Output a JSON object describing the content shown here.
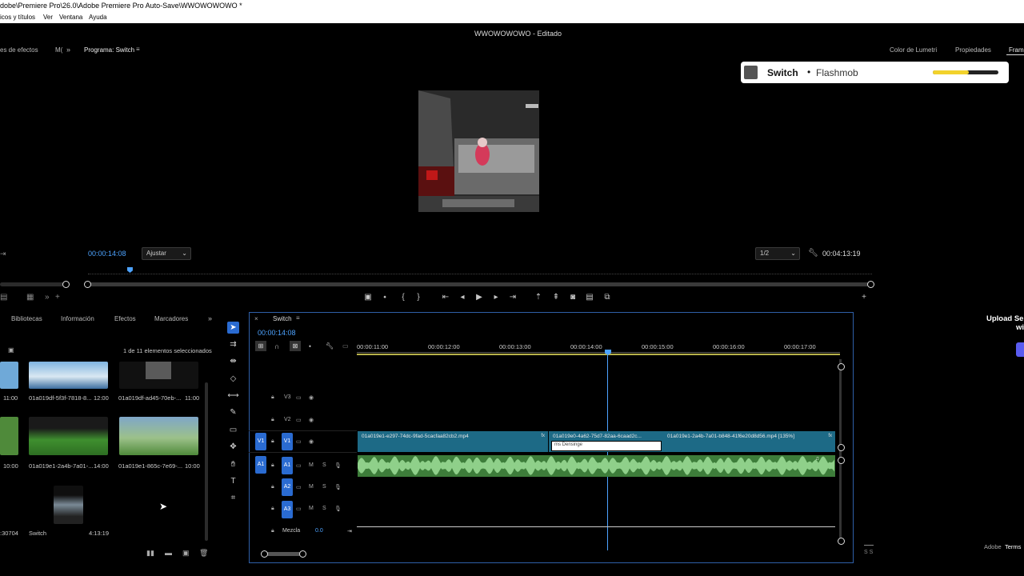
{
  "window": {
    "title": "dobe\\Premiere Pro\\26.0\\Adobe Premiere Pro Auto-Save\\WWOWOWOWO *",
    "menu": [
      "icos y títulos",
      "Ver",
      "Ventana",
      "Ayuda"
    ]
  },
  "header": {
    "doc_title": "WWOWOWOWO - Editado",
    "left_tabs": [
      "es de efectos",
      "M(",
      "Programa: Switch"
    ],
    "right_tabs": [
      "Color de Lumetri",
      "Propiedades",
      "Frame"
    ]
  },
  "overlay": {
    "name": "Switch",
    "separator": "•",
    "brand": "Flashmob",
    "progress": 0.55,
    "accent": "#f2d22c"
  },
  "program_monitor": {
    "timecode": "00:00:14:08",
    "fit_value": "Ajustar",
    "resolution": "1/2",
    "duration": "00:04:13:19",
    "playhead_fraction": 0.053
  },
  "project_panel": {
    "tabs": [
      "Bibliotecas",
      "Información",
      "Efectos",
      "Marcadores"
    ],
    "selection_status": "1 de 11 elementos seleccionados",
    "items": [
      {
        "label": "",
        "duration": "11:00"
      },
      {
        "label": "01a019df-5f3f-7818-8...",
        "duration": "12:00"
      },
      {
        "label": "01a019df-ad45-70eb-...",
        "duration": "11:00"
      },
      {
        "label": "",
        "duration": "10:00"
      },
      {
        "label": "01a019e1-2a4b-7a01-...",
        "duration": "14:00"
      },
      {
        "label": "01a019e1-865c-7e69-...",
        "duration": "10:00"
      },
      {
        "label": "",
        "duration": ":30704"
      },
      {
        "label": "Switch",
        "duration": "4:13:19"
      }
    ]
  },
  "timeline": {
    "sequence_name": "Switch",
    "timecode": "00:00:14:08",
    "ruler": [
      "00:00:11:00",
      "00:00:12:00",
      "00:00:13:00",
      "00:00:14:00",
      "00:00:15:00",
      "00:00:16:00",
      "00:00:17:00"
    ],
    "video_tracks": [
      "V3",
      "V2",
      "V1"
    ],
    "audio_tracks": [
      "A1",
      "A2",
      "A3"
    ],
    "source_patch_v": "V1",
    "source_patch_a": "A1",
    "clips": [
      {
        "name": "01a019e1-e297-74dc-9fad-5cacfaa82cb2.mp4"
      },
      {
        "name": "01a019e0-4a62-75d7-82aa-6caad2c..."
      },
      {
        "name": "01a019e1-2a4b-7a01-b848-41f6e20d8d56.mp4 [135%]"
      }
    ],
    "title_clip_text": "ms Densinge",
    "mix_label": "Mezcla",
    "mix_value": "0.0"
  },
  "side": {
    "upload_text": "Upload Se",
    "upload_text2": "wi",
    "adobe": "Adobe",
    "terms": "Terms"
  }
}
